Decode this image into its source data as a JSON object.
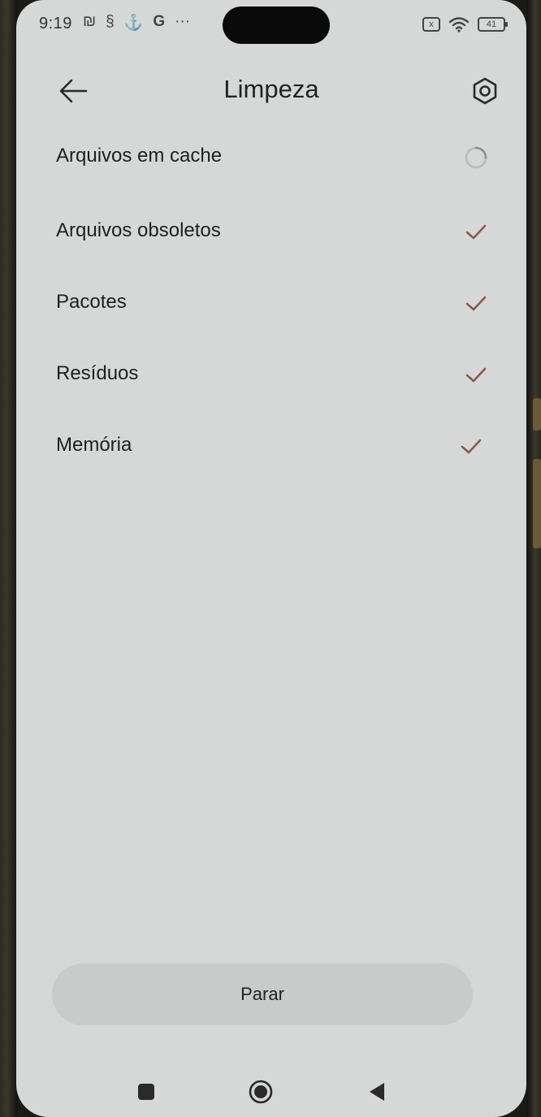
{
  "status_bar": {
    "time": "9:19",
    "left_icons": [
      "nfc-icon",
      "sync-icon",
      "anchor-icon",
      "google-icon",
      "more-dots-icon"
    ],
    "left_icon_glyphs": [
      "₪",
      "§",
      "⚓",
      "G",
      "···"
    ],
    "battery": "41",
    "sim_indicator": "x"
  },
  "header": {
    "title": "Limpeza"
  },
  "cleanup_items": [
    {
      "label": "Arquivos em cache",
      "state": "scanning"
    },
    {
      "label": "Arquivos obsoletos",
      "state": "done"
    },
    {
      "label": "Pacotes",
      "state": "done"
    },
    {
      "label": "Resíduos",
      "state": "done"
    },
    {
      "label": "Memória",
      "state": "done"
    }
  ],
  "stop_button": {
    "label": "Parar"
  },
  "nav_bar": {
    "items": [
      "recents-button",
      "home-button",
      "back-button"
    ]
  },
  "colors": {
    "screen_background": "#d5d8d7",
    "text": "#1f1f1f",
    "check": "#8a5a4a",
    "button_bg": "#c8cbca"
  }
}
